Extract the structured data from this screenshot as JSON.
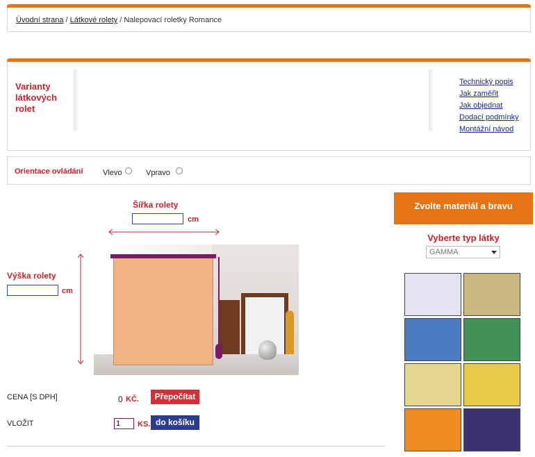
{
  "breadcrumb": {
    "home": "Úvodní strana",
    "sep1": " / ",
    "category": "Látkové rolety",
    "sep2": " / ",
    "current": "Nalepovací roletky Romance"
  },
  "variants": {
    "title": "Varianty látkových rolet",
    "links": [
      "Technický popis",
      "Jak zaměřit",
      "Jak objednat",
      "Dodací podmínky",
      "Montážní návod"
    ]
  },
  "orientation": {
    "label": "Orientace ovládání",
    "left": "Vlevo",
    "right": "Vpravo"
  },
  "config": {
    "width_label": "Šířka rolety",
    "height_label": "Výška rolety",
    "unit": "cm",
    "width_value": "",
    "height_value": ""
  },
  "price": {
    "label": "CENA [S DPH]",
    "value": "0",
    "currency": "KČ.",
    "recalc_button": "Přepočítat"
  },
  "cart": {
    "label": "VLOŽIT",
    "quantity": "1",
    "unit": "KS.",
    "button": "do košíku"
  },
  "material": {
    "header": "Zvolte materiál a bravu",
    "fabric_title": "Vyberte typ látky",
    "selected": "GAMMA",
    "swatches": [
      {
        "name": "light-lavender",
        "color": "#e4e4f2"
      },
      {
        "name": "khaki",
        "color": "#c9b87f"
      },
      {
        "name": "blue",
        "color": "#4c7bc0"
      },
      {
        "name": "green",
        "color": "#3f9253"
      },
      {
        "name": "light-yellow",
        "color": "#e4d790"
      },
      {
        "name": "yellow",
        "color": "#e8cc47"
      },
      {
        "name": "orange",
        "color": "#ee8b23"
      },
      {
        "name": "dark-purple",
        "color": "#3c3270"
      }
    ]
  },
  "colors": {
    "accent": "#e57514",
    "red": "#c8232c",
    "navy": "#2c3d8f"
  }
}
